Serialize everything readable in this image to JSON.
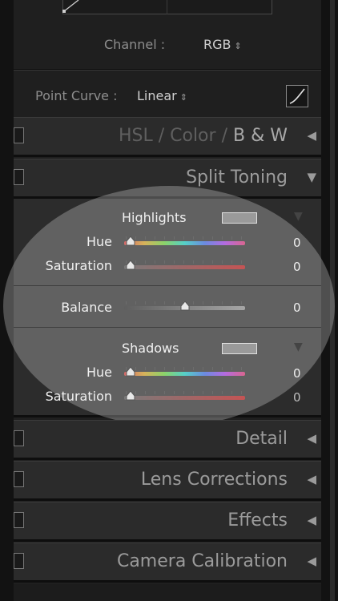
{
  "tone_curve": {
    "channel_label": "Channel :",
    "channel_value": "RGB",
    "point_curve_label": "Point Curve :",
    "point_curve_value": "Linear",
    "updown_icon": "updown-arrows-icon",
    "curve_button_icon": "curve-edit-icon"
  },
  "hsl_section": {
    "hsl": "HSL",
    "sep1": "/",
    "color": "Color",
    "sep2": "/",
    "bw": "B & W",
    "arrow": "◀"
  },
  "split_toning": {
    "title": "Split Toning",
    "arrow": "▼",
    "highlights": {
      "label": "Highlights",
      "swatch_color": "#9a9a9a",
      "hue_label": "Hue",
      "hue_value": "0",
      "saturation_label": "Saturation",
      "saturation_value": "0"
    },
    "balance": {
      "label": "Balance",
      "value": "0"
    },
    "shadows": {
      "label": "Shadows",
      "swatch_color": "#9a9a9a",
      "hue_label": "Hue",
      "hue_value": "0",
      "saturation_label": "Saturation",
      "saturation_value": "0"
    }
  },
  "sections": [
    {
      "title": "Detail",
      "arrow": "◀"
    },
    {
      "title": "Lens Corrections",
      "arrow": "◀"
    },
    {
      "title": "Effects",
      "arrow": "◀"
    },
    {
      "title": "Camera Calibration",
      "arrow": "◀"
    }
  ],
  "colors": {
    "panel_bg": "#2b2b2b",
    "highlight_overlay": "#dedede"
  }
}
